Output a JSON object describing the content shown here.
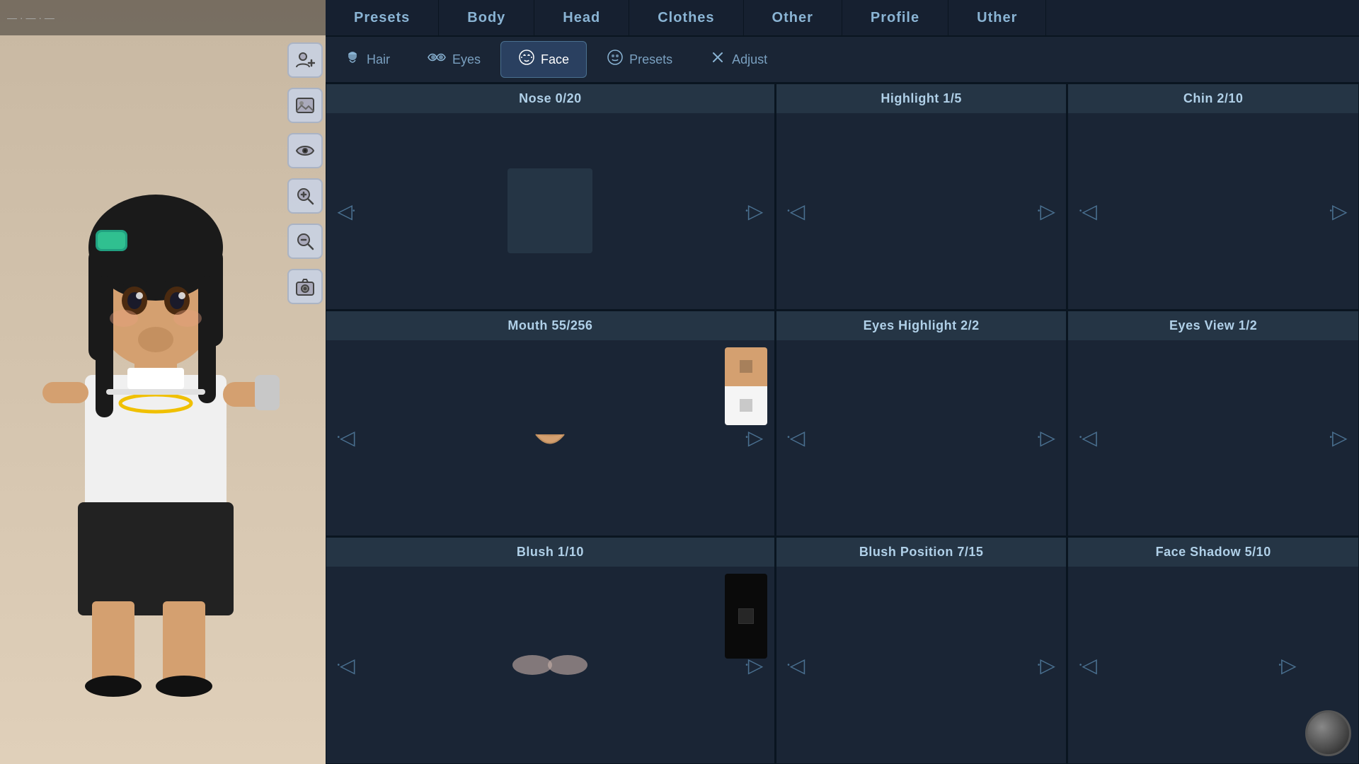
{
  "topBar": {
    "text": "— · — · —"
  },
  "tabs": [
    {
      "id": "presets",
      "label": "Presets"
    },
    {
      "id": "body",
      "label": "Body"
    },
    {
      "id": "head",
      "label": "Head"
    },
    {
      "id": "clothes",
      "label": "Clothes"
    },
    {
      "id": "other",
      "label": "Other"
    },
    {
      "id": "profile",
      "label": "Profile"
    },
    {
      "id": "uther",
      "label": "Uther"
    }
  ],
  "subTabs": [
    {
      "id": "hair",
      "label": "Hair",
      "icon": "👤",
      "active": false
    },
    {
      "id": "eyes",
      "label": "Eyes",
      "icon": "👁",
      "active": false
    },
    {
      "id": "face",
      "label": "Face",
      "icon": "😐",
      "active": true
    },
    {
      "id": "presets",
      "label": "Presets",
      "icon": "🙂",
      "active": false
    },
    {
      "id": "adjust",
      "label": "Adjust",
      "icon": "+",
      "active": false
    }
  ],
  "cells": [
    {
      "id": "nose",
      "header": "Nose 0/20",
      "hasPreview": true,
      "previewType": "empty",
      "hasColorSwatch": false,
      "col": 1,
      "row": 1
    },
    {
      "id": "highlight",
      "header": "Highlight 1/5",
      "hasPreview": false,
      "col": 2,
      "row": 1
    },
    {
      "id": "chin",
      "header": "Chin 2/10",
      "hasPreview": false,
      "col": 3,
      "row": 1
    },
    {
      "id": "mouth",
      "header": "Mouth 55/256",
      "hasPreview": true,
      "previewType": "mouth",
      "hasColorSwatch": true,
      "col": 1,
      "row": 2
    },
    {
      "id": "eyes-highlight",
      "header": "Eyes Highlight 2/2",
      "hasPreview": false,
      "col": 2,
      "row": 2
    },
    {
      "id": "eyes-view",
      "header": "Eyes View 1/2",
      "hasPreview": false,
      "col": 3,
      "row": 2
    },
    {
      "id": "blush",
      "header": "Blush 1/10",
      "hasPreview": true,
      "previewType": "blush",
      "hasColorSwatch": true,
      "swatchType": "black",
      "col": 1,
      "row": 3
    },
    {
      "id": "blush-position",
      "header": "Blush Position 7/15",
      "hasPreview": false,
      "col": 2,
      "row": 3
    },
    {
      "id": "face-shadow",
      "header": "Face Shadow 5/10",
      "hasPreview": false,
      "col": 3,
      "row": 3
    }
  ],
  "sidebar": {
    "buttons": [
      {
        "id": "add-person",
        "icon": "add-person-icon"
      },
      {
        "id": "image",
        "icon": "image-icon"
      },
      {
        "id": "eye",
        "icon": "eye-icon"
      },
      {
        "id": "zoom-in",
        "icon": "zoom-in-icon"
      },
      {
        "id": "zoom-out",
        "icon": "zoom-out-icon"
      },
      {
        "id": "camera",
        "icon": "camera-icon"
      }
    ]
  }
}
